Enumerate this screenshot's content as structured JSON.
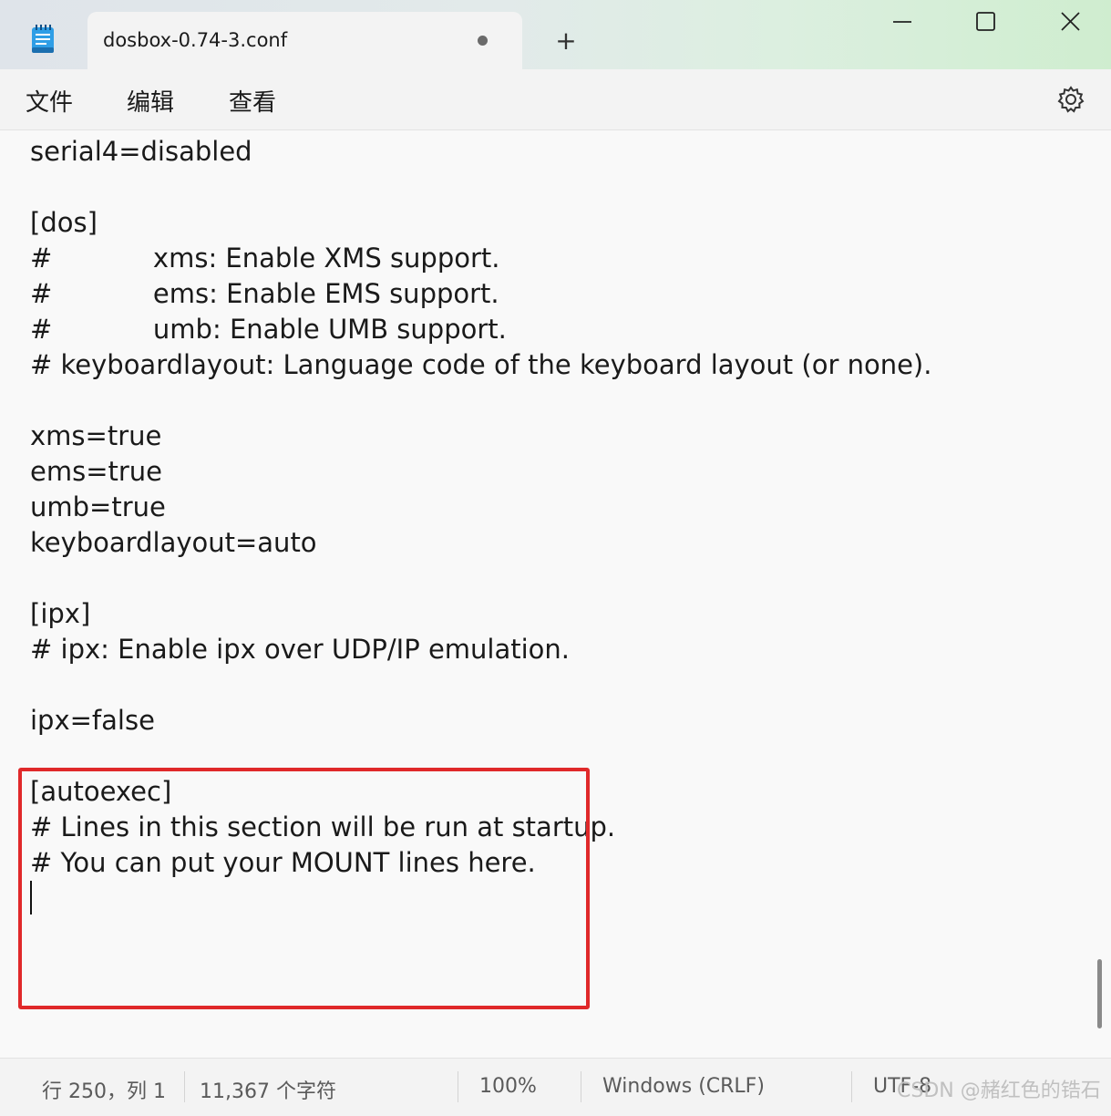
{
  "window": {
    "tab_title": "dosbox-0.74-3.conf",
    "new_tab_symbol": "+",
    "controls": [
      "minimize-icon",
      "maximize-icon",
      "close-icon"
    ]
  },
  "menu": {
    "items": [
      "文件",
      "编辑",
      "查看"
    ],
    "settings_icon": "gear-icon"
  },
  "editor": {
    "lines": [
      "serial4=disabled",
      "",
      "[dos]",
      "#            xms: Enable XMS support.",
      "#            ems: Enable EMS support.",
      "#            umb: Enable UMB support.",
      "# keyboardlayout: Language code of the keyboard layout (or none).",
      "",
      "xms=true",
      "ems=true",
      "umb=true",
      "keyboardlayout=auto",
      "",
      "[ipx]",
      "# ipx: Enable ipx over UDP/IP emulation.",
      "",
      "ipx=false",
      "",
      "[autoexec]",
      "# Lines in this section will be run at startup.",
      "# You can put your MOUNT lines here.",
      ""
    ],
    "highlight_color": "#e0292a"
  },
  "status": {
    "position": "行 250，列 1",
    "char_count": "11,367 个字符",
    "zoom": "100%",
    "line_ending": "Windows (CRLF)",
    "encoding": "UTF-8"
  },
  "watermark": "CSDN @赭红色的锆石"
}
